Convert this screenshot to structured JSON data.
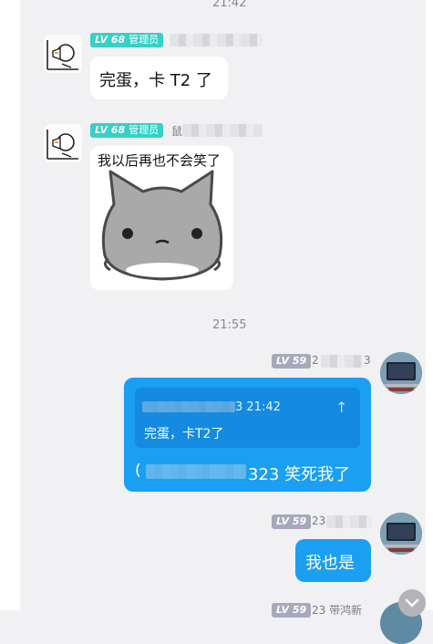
{
  "timestamps": {
    "top": "21:42",
    "mid": "21:55"
  },
  "msg1": {
    "level": "LV 68",
    "role": "管理员",
    "text": "完蛋，卡 T2 了"
  },
  "msg2": {
    "level": "LV 68",
    "role": "管理员",
    "name_fragment": "鼠",
    "caption": "我以后再也不会笑了"
  },
  "msg3": {
    "level": "LV 59",
    "name_fragment": "2",
    "name_tail": "3",
    "quote_time": "3 21:42",
    "quote_text": "完蛋，卡T2了",
    "reply_prefix": "(",
    "reply_tail": "323 笑死我了"
  },
  "msg4": {
    "level": "LV 59",
    "name_fragment": "23",
    "text": "我也是"
  },
  "bottom": {
    "level": "LV 59",
    "name": "23 带鸿新"
  },
  "icons": {
    "quote_close": "↑",
    "scroll_down": "chevron-down-icon"
  },
  "colors": {
    "blue_bubble": "#1a9ff2",
    "teal_badge": "#33d1c7",
    "gray_badge": "#a6a9bb",
    "background": "#f1f1f3"
  }
}
